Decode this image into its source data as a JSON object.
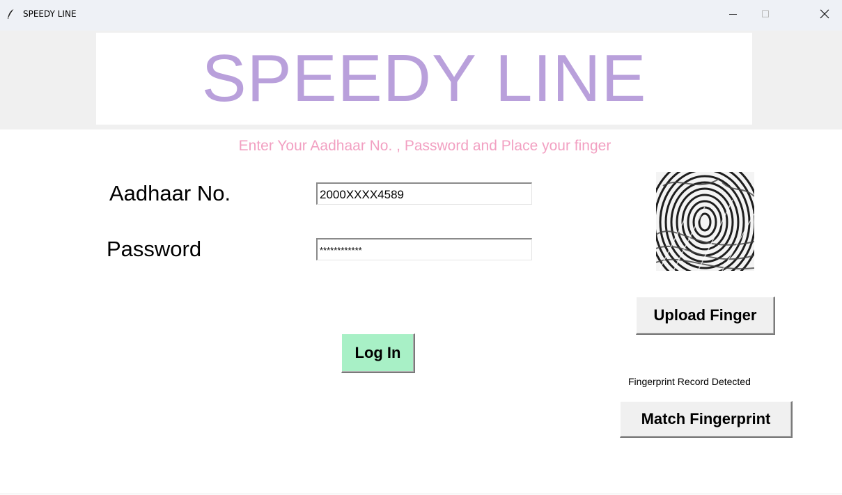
{
  "window": {
    "title": "SPEEDY LINE",
    "app_icon": "feather-icon",
    "controls": {
      "minimize": "minimize-icon",
      "maximize": "maximize-icon",
      "close": "close-icon"
    }
  },
  "header": {
    "app_title": "SPEEDY LINE",
    "title_color": "#b9a0db"
  },
  "subtitle": {
    "text": "Enter Your Aadhaar No. , Password and Place your finger",
    "color": "#f2a0c2"
  },
  "form": {
    "aadhaar_label": "Aadhaar No.",
    "aadhaar_value": "2000XXXX4589",
    "password_label": "Password",
    "password_value": "************"
  },
  "fingerprint": {
    "icon": "fingerprint-image"
  },
  "buttons": {
    "upload_label": "Upload Finger",
    "login_label": "Log In",
    "login_color": "#a8f0c6",
    "match_label": "Match Fingerprint"
  },
  "status": {
    "text": "Fingerprint Record Detected"
  }
}
